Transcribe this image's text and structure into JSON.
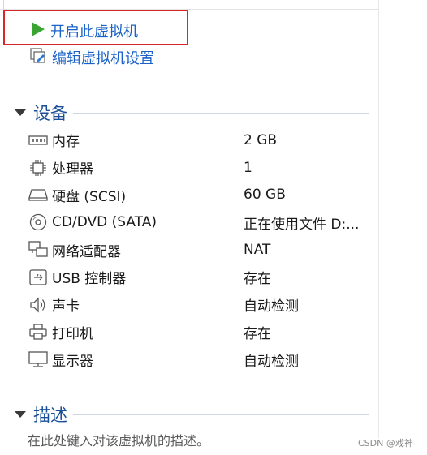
{
  "actions": {
    "start_vm": {
      "label": "开启此虚拟机",
      "icon": "play-icon"
    },
    "edit_settings": {
      "label": "编辑虚拟机设置",
      "icon": "edit-settings-icon"
    }
  },
  "devices": {
    "title": "设备",
    "items": [
      {
        "name": "内存",
        "value": "2 GB",
        "icon": "memory-icon"
      },
      {
        "name": "处理器",
        "value": "1",
        "icon": "processor-icon"
      },
      {
        "name": "硬盘 (SCSI)",
        "value": "60 GB",
        "icon": "hard-disk-icon"
      },
      {
        "name": "CD/DVD (SATA)",
        "value": "正在使用文件 D:...",
        "icon": "cd-dvd-icon"
      },
      {
        "name": "网络适配器",
        "value": "NAT",
        "icon": "network-adapter-icon"
      },
      {
        "name": "USB 控制器",
        "value": "存在",
        "icon": "usb-icon"
      },
      {
        "name": "声卡",
        "value": "自动检测",
        "icon": "sound-card-icon"
      },
      {
        "name": "打印机",
        "value": "存在",
        "icon": "printer-icon"
      },
      {
        "name": "显示器",
        "value": "自动检测",
        "icon": "display-icon"
      }
    ]
  },
  "description": {
    "title": "描述",
    "placeholder": "在此处键入对该虚拟机的描述。"
  },
  "watermark": "CSDN @戏神",
  "colors": {
    "accent": "#1a62c8",
    "heading": "#1a4f97",
    "highlight_box": "#d9262b",
    "play": "#3aa433"
  }
}
